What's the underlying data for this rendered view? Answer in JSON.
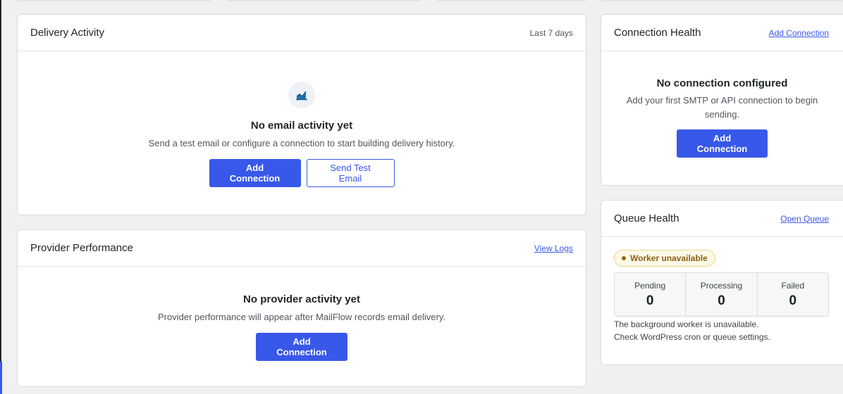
{
  "delivery_activity": {
    "title": "Delivery Activity",
    "range": "Last 7 days",
    "icon": "line-chart-icon",
    "empty_title": "No email activity yet",
    "empty_desc": "Send a test email or configure a connection to start building delivery history.",
    "primary_button": "Add Connection",
    "secondary_button": "Send Test Email"
  },
  "provider_performance": {
    "title": "Provider Performance",
    "link": "View Logs",
    "empty_title": "No provider activity yet",
    "empty_desc": "Provider performance will appear after MailFlow records email delivery.",
    "primary_button": "Add Connection"
  },
  "connection_health": {
    "title": "Connection Health",
    "link": "Add Connection",
    "empty_title": "No connection configured",
    "empty_desc_line1": "Add your first SMTP or API connection to begin",
    "empty_desc_line2": "sending.",
    "primary_button": "Add Connection"
  },
  "queue_health": {
    "title": "Queue Health",
    "link": "Open Queue",
    "status_badge": "Worker unavailable",
    "stats": [
      {
        "label": "Pending",
        "value": "0"
      },
      {
        "label": "Processing",
        "value": "0"
      },
      {
        "label": "Failed",
        "value": "0"
      }
    ],
    "note_line1": "The background worker is unavailable.",
    "note_line2": "Check WordPress cron or queue settings."
  },
  "colors": {
    "primary": "#3858e9",
    "warning_bg": "#fcf9e8",
    "warning_text": "#8a6116",
    "page_bg": "#f0f0f1"
  }
}
